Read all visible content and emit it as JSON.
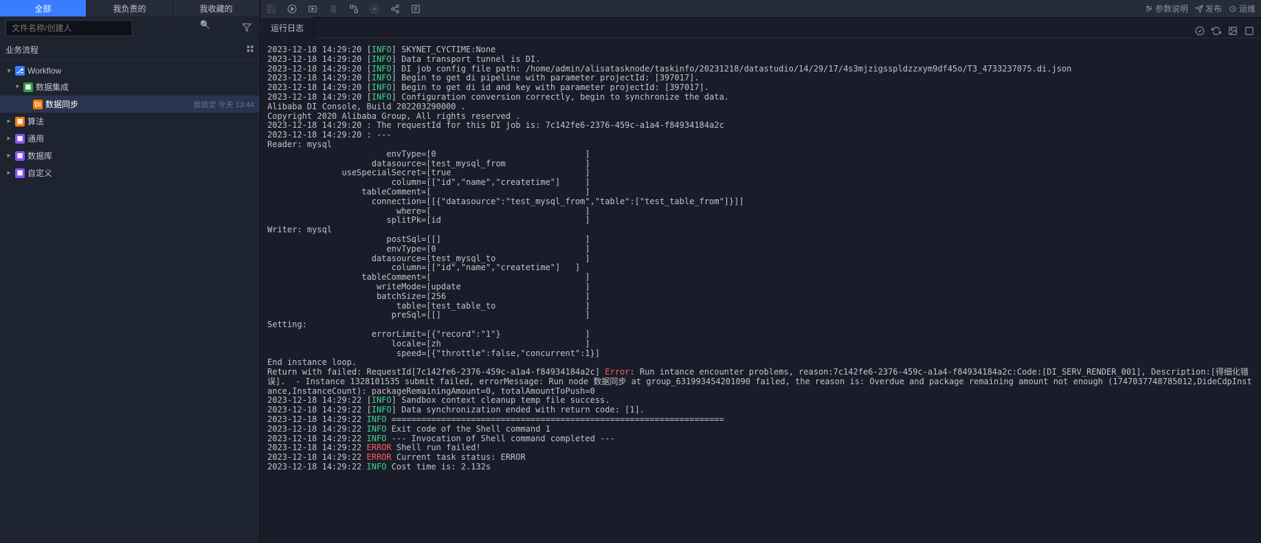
{
  "sidebar": {
    "tabs": [
      "全部",
      "我负责的",
      "我收藏的"
    ],
    "active_tab": 0,
    "search_placeholder": "文件名称/创建人",
    "section_title": "业务流程",
    "tree": [
      {
        "label": "Workflow",
        "icon": "flow",
        "has_chevron": true,
        "expanded": true,
        "indent": 0
      },
      {
        "label": "数据集成",
        "icon": "folder-green",
        "has_chevron": true,
        "expanded": true,
        "indent": 1
      },
      {
        "label": "数据同步",
        "icon": "di",
        "has_chevron": false,
        "indent": 2,
        "meta_lock": "我锁定",
        "meta_time": "今天 13:44",
        "active": true
      },
      {
        "label": "算法",
        "icon": "folder-orange",
        "has_chevron": true,
        "expanded": false,
        "indent": 0
      },
      {
        "label": "通用",
        "icon": "folder-purple",
        "has_chevron": true,
        "expanded": false,
        "indent": 0
      },
      {
        "label": "数据库",
        "icon": "folder-purple",
        "has_chevron": true,
        "expanded": false,
        "indent": 0
      },
      {
        "label": "自定义",
        "icon": "folder-purple",
        "has_chevron": true,
        "expanded": false,
        "indent": 0
      }
    ]
  },
  "toolbar_right": {
    "param_desc": "参数说明",
    "publish": "发布",
    "ops": "运维"
  },
  "log_tab_label": "运行日志",
  "log_lines": [
    {
      "ts": "2023-12-18 14:29:20",
      "lvl": "INFO",
      "msg": "SKYNET_CYCTIME:None"
    },
    {
      "ts": "2023-12-18 14:29:20",
      "lvl": "INFO",
      "msg": "Data transport tunnel is DI."
    },
    {
      "ts": "2023-12-18 14:29:20",
      "lvl": "INFO",
      "msg": "DI job config file path: /home/admin/alisatasknode/taskinfo/20231218/datastudio/14/29/17/4s3mjzigsspldzzxym9df45o/T3_4733237075.di.json"
    },
    {
      "ts": "2023-12-18 14:29:20",
      "lvl": "INFO",
      "msg": "Begin to get di pipeline with parameter projectId: [397017]."
    },
    {
      "ts": "2023-12-18 14:29:20",
      "lvl": "INFO",
      "msg": "Begin to get di id and key with parameter projectId: [397017]."
    },
    {
      "ts": "2023-12-18 14:29:20",
      "lvl": "INFO",
      "msg": "Configuration conversion correctly, begin to synchronize the data."
    },
    {
      "raw": "Alibaba DI Console, Build 202203290000 ."
    },
    {
      "raw": "Copyright 2020 Alibaba Group, All rights reserved ."
    },
    {
      "raw": "2023-12-18 14:29:20 : The requestId for this DI job is: 7c142fe6-2376-459c-a1a4-f84934184a2c"
    },
    {
      "raw": "2023-12-18 14:29:20 : ---"
    },
    {
      "raw": "Reader: mysql"
    },
    {
      "raw": "                        envType=[0                              ]"
    },
    {
      "raw": "                     datasource=[test_mysql_from                ]"
    },
    {
      "raw": "               useSpecialSecret=[true                           ]"
    },
    {
      "raw": "                         column=[[\"id\",\"name\",\"createtime\"]     ]"
    },
    {
      "raw": "                   tableComment=[                               ]"
    },
    {
      "raw": "                     connection=[[{\"datasource\":\"test_mysql_from\",\"table\":[\"test_table_from\"]}]]"
    },
    {
      "raw": "                          where=[                               ]"
    },
    {
      "raw": "                        splitPk=[id                             ]"
    },
    {
      "raw": "Writer: mysql"
    },
    {
      "raw": "                        postSql=[[]                             ]"
    },
    {
      "raw": "                        envType=[0                              ]"
    },
    {
      "raw": "                     datasource=[test_mysql_to                  ]"
    },
    {
      "raw": "                         column=[[\"id\",\"name\",\"createtime\"]   ]"
    },
    {
      "raw": "                   tableComment=[                               ]"
    },
    {
      "raw": "                      writeMode=[update                         ]"
    },
    {
      "raw": "                      batchSize=[256                            ]"
    },
    {
      "raw": "                          table=[test_table_to                  ]"
    },
    {
      "raw": "                         preSql=[[]                             ]"
    },
    {
      "raw": "Setting: "
    },
    {
      "raw": "                     errorLimit=[{\"record\":\"1\"}                 ]"
    },
    {
      "raw": "                         locale=[zh                             ]"
    },
    {
      "raw": "                          speed=[{\"throttle\":false,\"concurrent\":1}]"
    },
    {
      "raw": "End instance loop."
    },
    {
      "raw_pre": "Return with failed: RequestId[7c142fe6-2376-459c-a1a4-f84934184a2c] ",
      "lvl_inline": "Error",
      "raw_post": ": Run intance encounter problems, reason:7c142fe6-2376-459c-a1a4-f84934184a2c:Code:[DI_SERV_RENDER_001], Description:[得细化错误].  - Instance 1328101535 submit failed, errorMessage: Run node 数据同步 at group_631993454201090 failed, the reason is: Overdue and package remaining amount not enough (1747037748785012,DideCdpInstance,InstanceCount): packageRemainingAmount=0, totalAmountToPush=0"
    },
    {
      "ts": "2023-12-18 14:29:22",
      "lvl": "INFO",
      "msg": "Sandbox context cleanup temp file success."
    },
    {
      "ts": "2023-12-18 14:29:22",
      "lvl": "INFO",
      "msg": "Data synchronization ended with return code: [1]."
    },
    {
      "ts2": "2023-12-18 14:29:22",
      "lvl2": "INFO",
      "msg2": "==================================================================="
    },
    {
      "ts2": "2023-12-18 14:29:22",
      "lvl2": "INFO",
      "msg2": "Exit code of the Shell command 1"
    },
    {
      "ts2": "2023-12-18 14:29:22",
      "lvl2": "INFO",
      "msg2": "--- Invocation of Shell command completed ---"
    },
    {
      "ts2": "2023-12-18 14:29:22",
      "lvl2": "ERROR",
      "msg2": "Shell run failed!"
    },
    {
      "ts2": "2023-12-18 14:29:22",
      "lvl2": "ERROR",
      "msg2": "Current task status: ERROR"
    },
    {
      "ts2": "2023-12-18 14:29:22",
      "lvl2": "INFO",
      "msg2": "Cost time is: 2.132s"
    }
  ]
}
